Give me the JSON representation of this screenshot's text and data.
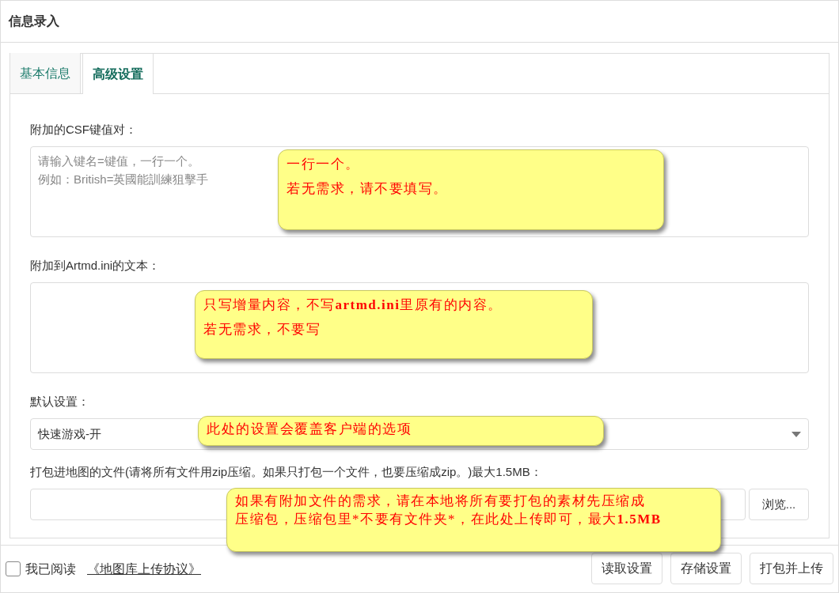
{
  "window": {
    "title": "信息录入"
  },
  "tabs": [
    {
      "label": "基本信息",
      "selected": false
    },
    {
      "label": "高级设置",
      "selected": true
    }
  ],
  "fields": [
    {
      "kind": "textarea",
      "label": "附加的CSF键值对：",
      "placeholder": [
        "请输入键名=键值，一行一个。",
        "例如：British=英國能訓練狙擊手"
      ],
      "note": [
        "一行一个。",
        "若无需求，请不要填写。"
      ]
    },
    {
      "kind": "textarea",
      "label": "附加到Artmd.ini的文本：",
      "note": [
        "只写增量内容，不写**artmd.ini**里原有的内容。",
        "若无需求，不要写"
      ]
    },
    {
      "kind": "select",
      "label": "默认设置：",
      "value": "快速游戏-开",
      "note": [
        "此处的设置会覆盖客户端的选项"
      ]
    },
    {
      "kind": "file",
      "label": "打包进地图的文件(请将所有文件用zip压缩。如果只打包一个文件，也要压缩成zip。)最大1.5MB：",
      "button": "浏览...",
      "note": [
        "如果有附加文件的需求，请在本地将所有要打包的素材先压缩成",
        "压缩包，压缩包里*不要有文件夹*，在此处上传即可，最大**1.5MB**"
      ]
    }
  ],
  "footer": {
    "agree": {
      "checked": false,
      "label": "我已阅读",
      "link": "《地图库上传协议》"
    },
    "buttons": [
      "读取设置",
      "存储设置",
      "打包并上传"
    ]
  }
}
